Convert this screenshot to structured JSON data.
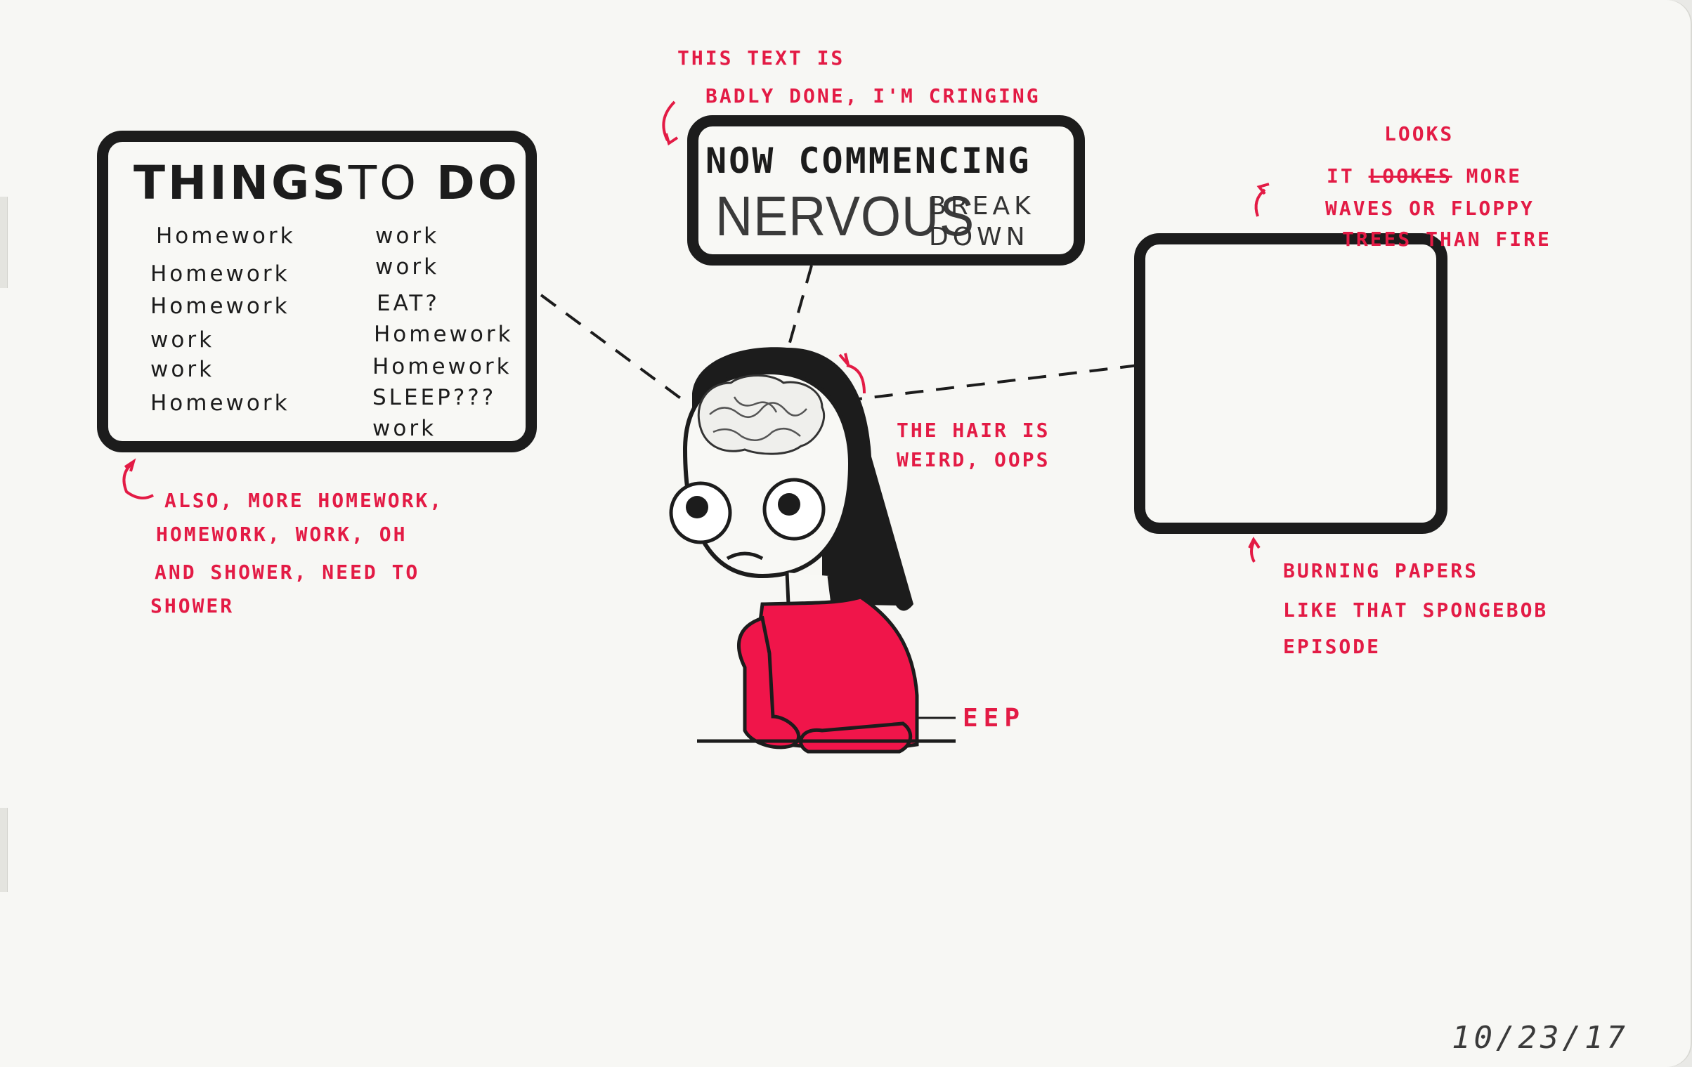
{
  "todo": {
    "title_part1": "THINGS",
    "title_part2": "TO",
    "title_part3": "DO",
    "col1": [
      "Homework",
      "Homework",
      "Homework",
      "work",
      "work",
      "Homework"
    ],
    "col2": [
      "work",
      "work",
      "EAT?",
      "Homework",
      "Homework",
      "SLEEP???",
      "work"
    ]
  },
  "banner": {
    "line1": "NOW COMMENCING",
    "nervous": "NERVOUS",
    "break": "BREAK",
    "down": "DOWN"
  },
  "notes": {
    "text_cringe_1": "THIS TEXT IS",
    "text_cringe_2": "BADLY DONE, I'M CRINGING",
    "looks": "LOOKS",
    "it": "IT",
    "lookes_struck": "LOOKES",
    "more": "MORE",
    "waves": "WAVES OR FLOPPY",
    "trees": "TREES THAN FIRE",
    "hair_1": "THE HAIR IS",
    "hair_2": "WEIRD, OOPS",
    "also_1": "ALSO, MORE HOMEWORK,",
    "also_2": "HOMEWORK, WORK, OH",
    "also_3": "AND SHOWER, NEED TO",
    "also_4": "SHOWER",
    "burning_1": "BURNING PAPERS",
    "burning_2": "LIKE THAT SPONGEBOB",
    "burning_3": "EPISODE",
    "eep": "EEP"
  },
  "date": "10/23/17",
  "colors": {
    "ink": "#1c1c1c",
    "red": "#e31b45",
    "paper": "#f7f7f4"
  }
}
